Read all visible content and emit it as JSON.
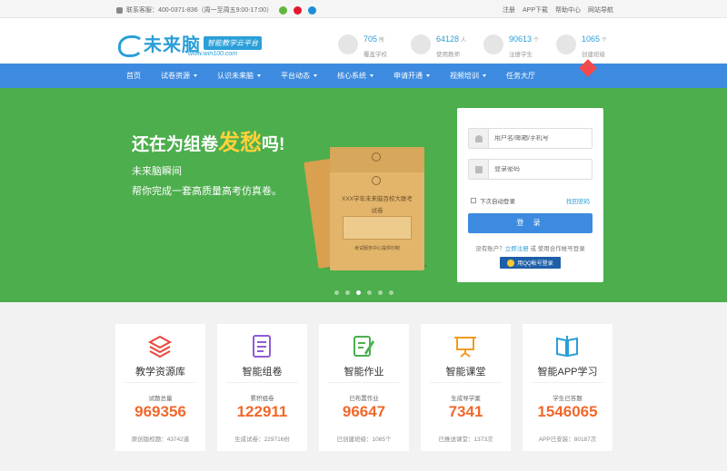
{
  "topbar": {
    "hotline": "联系客服：400-0371-836（周一至周五9:00-17:00）",
    "links": [
      "注册",
      "APP下载",
      "帮助中心",
      "网站导航"
    ]
  },
  "logo": {
    "name": "未来脑",
    "tagline": "智能教学云平台",
    "url": "www.win100.com"
  },
  "top_stats": [
    {
      "num": "705",
      "unit": "所",
      "label": "覆盖学校"
    },
    {
      "num": "64128",
      "unit": "人",
      "label": "使用教师"
    },
    {
      "num": "90613",
      "unit": "个",
      "label": "注册学生"
    },
    {
      "num": "1065",
      "unit": "个",
      "label": "创建班级"
    }
  ],
  "nav": [
    {
      "label": "首页",
      "dropdown": false
    },
    {
      "label": "试卷资源",
      "dropdown": true
    },
    {
      "label": "认识未来脑",
      "dropdown": true
    },
    {
      "label": "平台动态",
      "dropdown": true
    },
    {
      "label": "核心系统",
      "dropdown": true
    },
    {
      "label": "申请开通",
      "dropdown": true
    },
    {
      "label": "视频培训",
      "dropdown": true
    },
    {
      "label": "任务大厅",
      "dropdown": false
    }
  ],
  "banner": {
    "line1_a": "还在为组卷",
    "line1_hl": "发愁",
    "line1_b": "吗!",
    "line2": "未来脑瞬间",
    "line3": "帮你完成一套高质量高考仿真卷。",
    "envelope_title": "XXX学年未来脑百校大联考",
    "envelope_sub": "试卷",
    "envelope_foot": "考试服务中心提供印制",
    "dots": [
      false,
      false,
      true,
      false,
      false,
      false
    ]
  },
  "login": {
    "username_placeholder": "用户名/邮箱/手机号",
    "password_placeholder": "登录密码",
    "remember": "下次自动登录",
    "forgot": "找回密码",
    "submit": "登 录",
    "no_account": "没有账户？",
    "register": "立即注册",
    "or_partner": "或 使用合作帐号登录",
    "qq_login": "用QQ帐号登录"
  },
  "cards": [
    {
      "name": "教学资源库",
      "label": "试题总量",
      "num": "969356",
      "foot": "原创版权题：43742道",
      "icon": "layers-icon",
      "color": "#e8453c"
    },
    {
      "name": "智能组卷",
      "label": "累积组卷",
      "num": "122911",
      "foot": "生成试卷：229716份",
      "icon": "list-doc-icon",
      "color": "#8e5bd6"
    },
    {
      "name": "智能作业",
      "label": "已布置作业",
      "num": "96647",
      "foot": "已创建班级：1065个",
      "icon": "edit-doc-icon",
      "color": "#4caf50"
    },
    {
      "name": "智能课堂",
      "label": "生成导学案",
      "num": "7341",
      "foot": "已推送课堂：1373次",
      "icon": "board-icon",
      "color": "#f29b1d"
    },
    {
      "name": "智能APP学习",
      "label": "学生已答题",
      "num": "1546065",
      "foot": "APP已安装：80187次",
      "icon": "book-icon",
      "color": "#2a9fd8"
    }
  ]
}
